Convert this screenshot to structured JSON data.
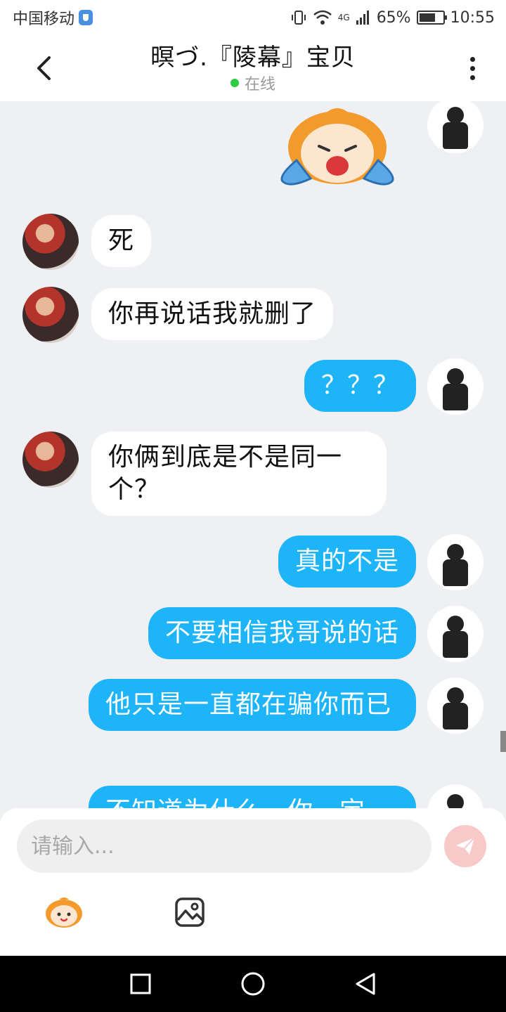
{
  "status_bar": {
    "carrier": "中国移动",
    "network": "4G",
    "battery": "65%",
    "time": "10:55"
  },
  "header": {
    "title": "暝づ.『陵幕』宝贝",
    "status": "在线"
  },
  "messages": [
    {
      "side": "in",
      "text": "死"
    },
    {
      "side": "in",
      "text": "你再说话我就删了"
    },
    {
      "side": "out",
      "text": "？？？"
    },
    {
      "side": "in",
      "text": "你俩到底是不是同一个？"
    },
    {
      "side": "out",
      "text": "真的不是"
    },
    {
      "side": "out",
      "text": "不要相信我哥说的话"
    },
    {
      "side": "out",
      "text": "他只是一直都在骗你而已"
    },
    {
      "side": "out",
      "text": "不知道为什么一你一定"
    }
  ],
  "input": {
    "placeholder": "请输入..."
  },
  "colors": {
    "accent": "#1eb4f8",
    "background": "#eef0f4",
    "online": "#2ecc40",
    "send_disabled": "#f7c9c9"
  }
}
